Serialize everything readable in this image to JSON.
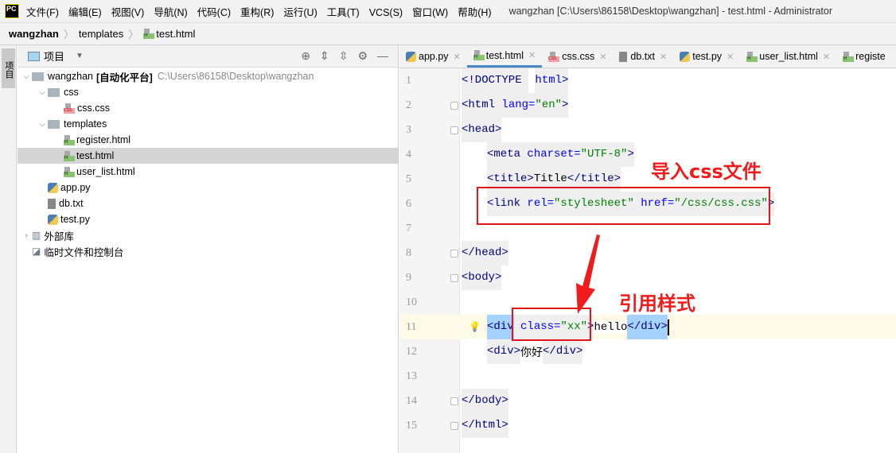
{
  "menubar": {
    "logo": "PC",
    "items": [
      "文件(F)",
      "编辑(E)",
      "视图(V)",
      "导航(N)",
      "代码(C)",
      "重构(R)",
      "运行(U)",
      "工具(T)",
      "VCS(S)",
      "窗口(W)",
      "帮助(H)"
    ],
    "window_title": "wangzhan [C:\\Users\\86158\\Desktop\\wangzhan] - test.html - Administrator"
  },
  "breadcrumb": [
    "wangzhan",
    "templates",
    "test.html"
  ],
  "sidestrip": {
    "tab": "项目"
  },
  "project": {
    "title": "项目",
    "tree": [
      {
        "label": "wangzhan",
        "bold": "[自动化平台]",
        "path": "C:\\Users\\86158\\Desktop\\wangzhan",
        "indent": 0,
        "icon": "folder",
        "arrow": "open"
      },
      {
        "label": "css",
        "indent": 1,
        "icon": "folder",
        "arrow": "open"
      },
      {
        "label": "css.css",
        "indent": 2,
        "icon": "css"
      },
      {
        "label": "templates",
        "indent": 1,
        "icon": "folder",
        "arrow": "open"
      },
      {
        "label": "register.html",
        "indent": 2,
        "icon": "html"
      },
      {
        "label": "test.html",
        "indent": 2,
        "icon": "html",
        "selected": true
      },
      {
        "label": "user_list.html",
        "indent": 2,
        "icon": "html"
      },
      {
        "label": "app.py",
        "indent": 1,
        "icon": "py"
      },
      {
        "label": "db.txt",
        "indent": 1,
        "icon": "txt"
      },
      {
        "label": "test.py",
        "indent": 1,
        "icon": "py"
      },
      {
        "label": "外部库",
        "indent": 0,
        "icon": "lib",
        "arrow": "closed"
      },
      {
        "label": "临时文件和控制台",
        "indent": 0,
        "icon": "scratch"
      }
    ]
  },
  "tabs": [
    {
      "label": "app.py",
      "icon": "py"
    },
    {
      "label": "test.html",
      "icon": "html",
      "active": true
    },
    {
      "label": "css.css",
      "icon": "css"
    },
    {
      "label": "db.txt",
      "icon": "txt"
    },
    {
      "label": "test.py",
      "icon": "py"
    },
    {
      "label": "user_list.html",
      "icon": "html"
    },
    {
      "label": "registe",
      "icon": "html"
    }
  ],
  "code": [
    [
      [
        "t",
        "<!DOCTYPE "
      ],
      [
        "sp",
        " "
      ],
      [
        "t a",
        "html"
      ],
      [
        "t",
        ">"
      ]
    ],
    [
      [
        "t",
        "<html "
      ],
      [
        "t a",
        "lang="
      ],
      [
        "t v",
        "\"en\""
      ],
      [
        "t",
        ">"
      ]
    ],
    [
      [
        "t",
        "<head>"
      ]
    ],
    [
      [
        "t",
        "<meta "
      ],
      [
        "t a",
        "charset="
      ],
      [
        "t v",
        "\"UTF-8\""
      ],
      [
        "t",
        ">"
      ]
    ],
    [
      [
        "t",
        "<title>"
      ],
      [
        "t x2",
        "Title"
      ],
      [
        "t",
        "</title>"
      ]
    ],
    [
      [
        "t",
        "<link "
      ],
      [
        "t a",
        "rel="
      ],
      [
        "t v",
        "\"stylesheet\" "
      ],
      [
        "t a",
        "href="
      ],
      [
        "t v",
        "\"/css/css.css\""
      ],
      [
        "t",
        ">"
      ]
    ],
    [],
    [
      [
        "t",
        "</head>"
      ]
    ],
    [
      [
        "t",
        "<body>"
      ]
    ],
    [],
    [
      [
        "t hl",
        "<div"
      ],
      [
        "t a",
        " class="
      ],
      [
        "t v",
        "\"xx\""
      ],
      [
        "t",
        ">"
      ],
      [
        "x",
        "hello"
      ],
      [
        "t hl",
        "</div>"
      ],
      [
        "caret",
        ""
      ]
    ],
    [
      [
        "t",
        "<div>"
      ],
      [
        "x",
        "你好"
      ],
      [
        "t",
        "</div>"
      ]
    ],
    [],
    [
      [
        "t",
        "</body>"
      ]
    ],
    [
      [
        "t",
        "</html>"
      ]
    ]
  ],
  "annotations": {
    "import_css": "导入css文件",
    "use_style": "引用样式"
  },
  "colors": {
    "annotation": "#e5141a",
    "tag": "#000080",
    "attr": "#0000ff",
    "value": "#008000",
    "accent": "#4a88c7"
  }
}
